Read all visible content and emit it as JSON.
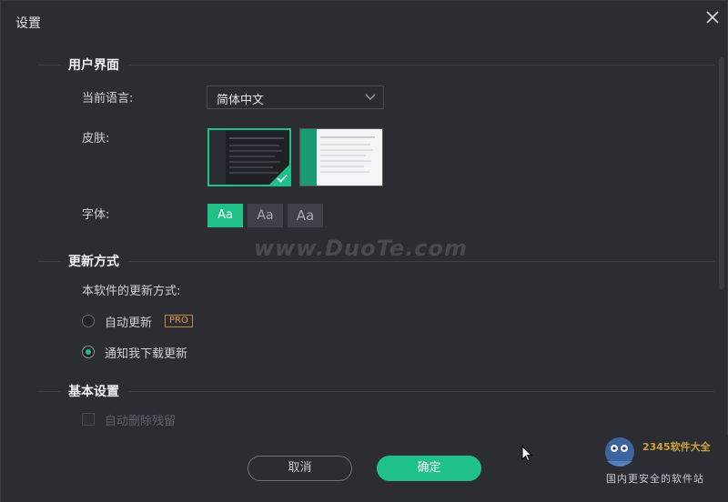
{
  "window": {
    "title": "设置"
  },
  "ui_section": {
    "title": "用户界面",
    "language_label": "当前语言:",
    "language_value": "简体中文",
    "skin_label": "皮肤:",
    "font_label": "字体:",
    "font_options": [
      "Aa",
      "Aa",
      "Aa"
    ]
  },
  "update_section": {
    "title": "更新方式",
    "description": "本软件的更新方式:",
    "options": [
      {
        "label": "自动更新",
        "selected": false,
        "badge": "PRO"
      },
      {
        "label": "通知我下载更新",
        "selected": true
      }
    ]
  },
  "basic_section": {
    "title": "基本设置",
    "auto_delete_label": "自动删除残留"
  },
  "watermark": "www.DuoTe.com",
  "footer": {
    "cancel_label": "取消",
    "ok_label": "确定"
  },
  "logo": {
    "brand": "2345软件大全",
    "tagline": "国内更安全的软件站"
  },
  "colors": {
    "accent": "#1fc089",
    "background": "#2b2d33",
    "pro_badge": "#e29a44"
  }
}
